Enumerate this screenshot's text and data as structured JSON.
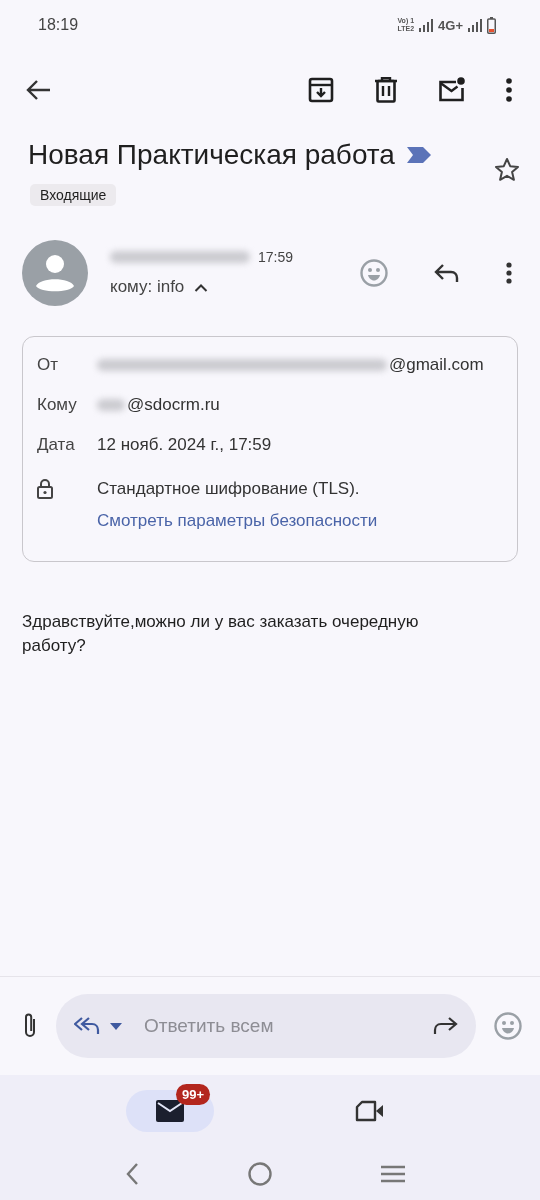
{
  "status_bar": {
    "time": "18:19",
    "volte": "Vo) 1",
    "sim": "LTE2",
    "network": "4G+"
  },
  "subject": "Новая Практическая работа",
  "important": true,
  "starred": false,
  "label": "Входящие",
  "sender": {
    "name_hidden": true,
    "time": "17:59",
    "recipients": "кому: info",
    "expanded": true
  },
  "details": [
    {
      "kind": "field",
      "label": "От",
      "hidden_part": true,
      "value": "@gmail.com"
    },
    {
      "kind": "field",
      "label": "Кому",
      "hidden_part": true,
      "value": "@sdocrm.ru"
    },
    {
      "kind": "field",
      "label": "Дата",
      "hidden_part": false,
      "value": "12 нояб. 2024 г., 17:59"
    },
    {
      "kind": "security",
      "value": "Стандартное шифрование (TLS).",
      "link": "Смотреть параметры безопасности"
    }
  ],
  "body": "Здравствуйте,можно ли у вас заказать очередную работу?",
  "reply_bar": {
    "placeholder": "Ответить всем"
  },
  "bottom_nav": [
    {
      "kind": "mail",
      "badge": "99+",
      "selected": true
    },
    {
      "kind": "video",
      "selected": false
    }
  ]
}
